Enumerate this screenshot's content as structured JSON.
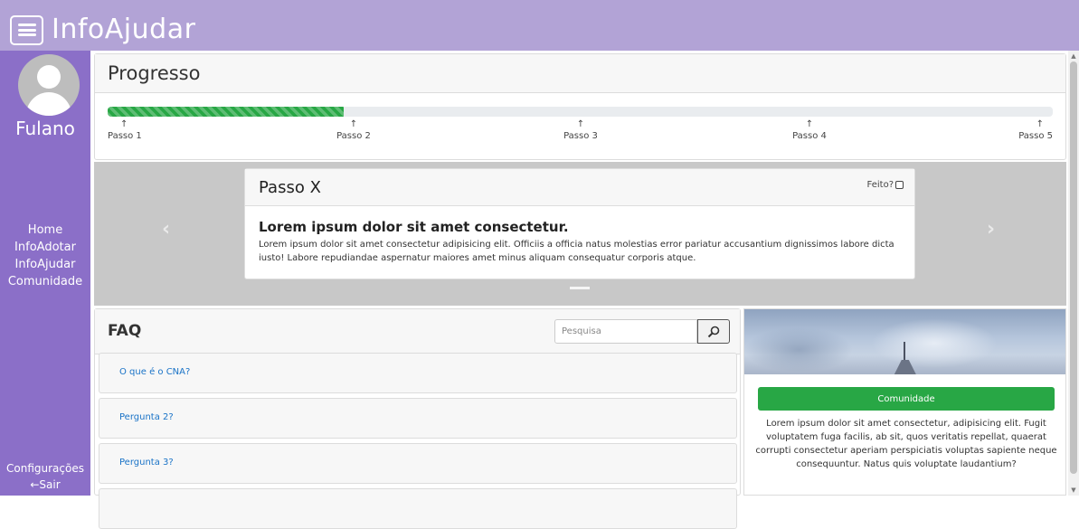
{
  "app": {
    "title": "InfoAjudar"
  },
  "sidebar": {
    "username": "Fulano",
    "nav": [
      {
        "label": "Home"
      },
      {
        "label": "InfoAdotar"
      },
      {
        "label": "InfoAjudar"
      },
      {
        "label": "Comunidade"
      }
    ],
    "settings_label": "Configurações",
    "logout_label": "←Sair"
  },
  "progress": {
    "title": "Progresso",
    "percent": 25,
    "steps": [
      {
        "arrow": "↑",
        "label": "Passo 1"
      },
      {
        "arrow": "↑",
        "label": "Passo 2"
      },
      {
        "arrow": "↑",
        "label": "Passo 3"
      },
      {
        "arrow": "↑",
        "label": "Passo 4"
      },
      {
        "arrow": "↑",
        "label": "Passo 5"
      }
    ]
  },
  "carousel": {
    "prev_label": "‹",
    "next_label": "›",
    "slide": {
      "title": "Passo X",
      "done_label": "Feito?",
      "done_checked": false,
      "heading": "Lorem ipsum dolor sit amet consectetur.",
      "text": "Lorem ipsum dolor sit amet consectetur adipisicing elit. Officiis a officia natus molestias error pariatur accusantium dignissimos labore dicta iusto! Labore repudiandae aspernatur maiores amet minus aliquam consequatur corporis atque."
    }
  },
  "faq": {
    "title": "FAQ",
    "search_placeholder": "Pesquisa",
    "search_icon": "magnifier-icon",
    "items": [
      {
        "label": "O que é o CNA?"
      },
      {
        "label": "Pergunta 2?"
      },
      {
        "label": "Pergunta 3?"
      }
    ]
  },
  "community": {
    "button_label": "Comunidade",
    "text": "Lorem ipsum dolor sit amet consectetur, adipisicing elit. Fugit voluptatem fuga facilis, ab sit, quos veritatis repellat, quaerat corrupti consectetur aperiam perspiciatis voluptas sapiente neque consequuntur. Natus quis voluptate laudantium?"
  },
  "colors": {
    "topbar": "#b2a3d6",
    "sidebar": "#8b6fc8",
    "progress_fill": "#28a745",
    "community_button": "#28a745",
    "link": "#1a73c7"
  }
}
